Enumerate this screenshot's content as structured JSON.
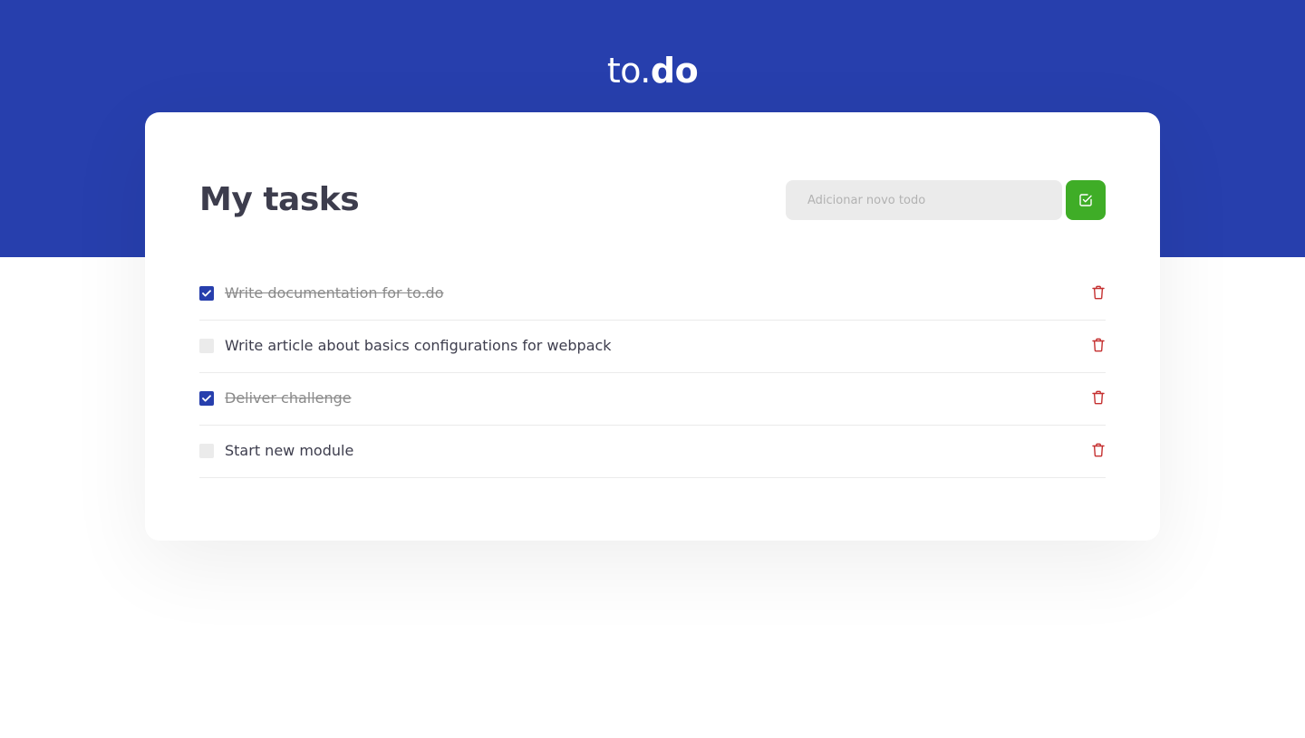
{
  "header": {
    "logo_light": "to.",
    "logo_bold": "do"
  },
  "main": {
    "title": "My tasks",
    "input": {
      "placeholder": "Adicionar novo todo",
      "value": ""
    },
    "add_button_icon": "check-square-icon"
  },
  "tasks": [
    {
      "text": "Write documentation for to.do",
      "done": true
    },
    {
      "text": "Write article about basics configurations for webpack",
      "done": false
    },
    {
      "text": "Deliver challenge",
      "done": true
    },
    {
      "text": "Start new module",
      "done": false
    }
  ],
  "colors": {
    "brand": "#273fad",
    "add_button": "#3fad27",
    "delete_icon": "#c53030",
    "text": "#3d3d4d",
    "done_text": "#8a8a8a",
    "input_bg": "#ebebeb"
  },
  "icons": {
    "check": "check-icon",
    "delete": "trash-icon"
  }
}
